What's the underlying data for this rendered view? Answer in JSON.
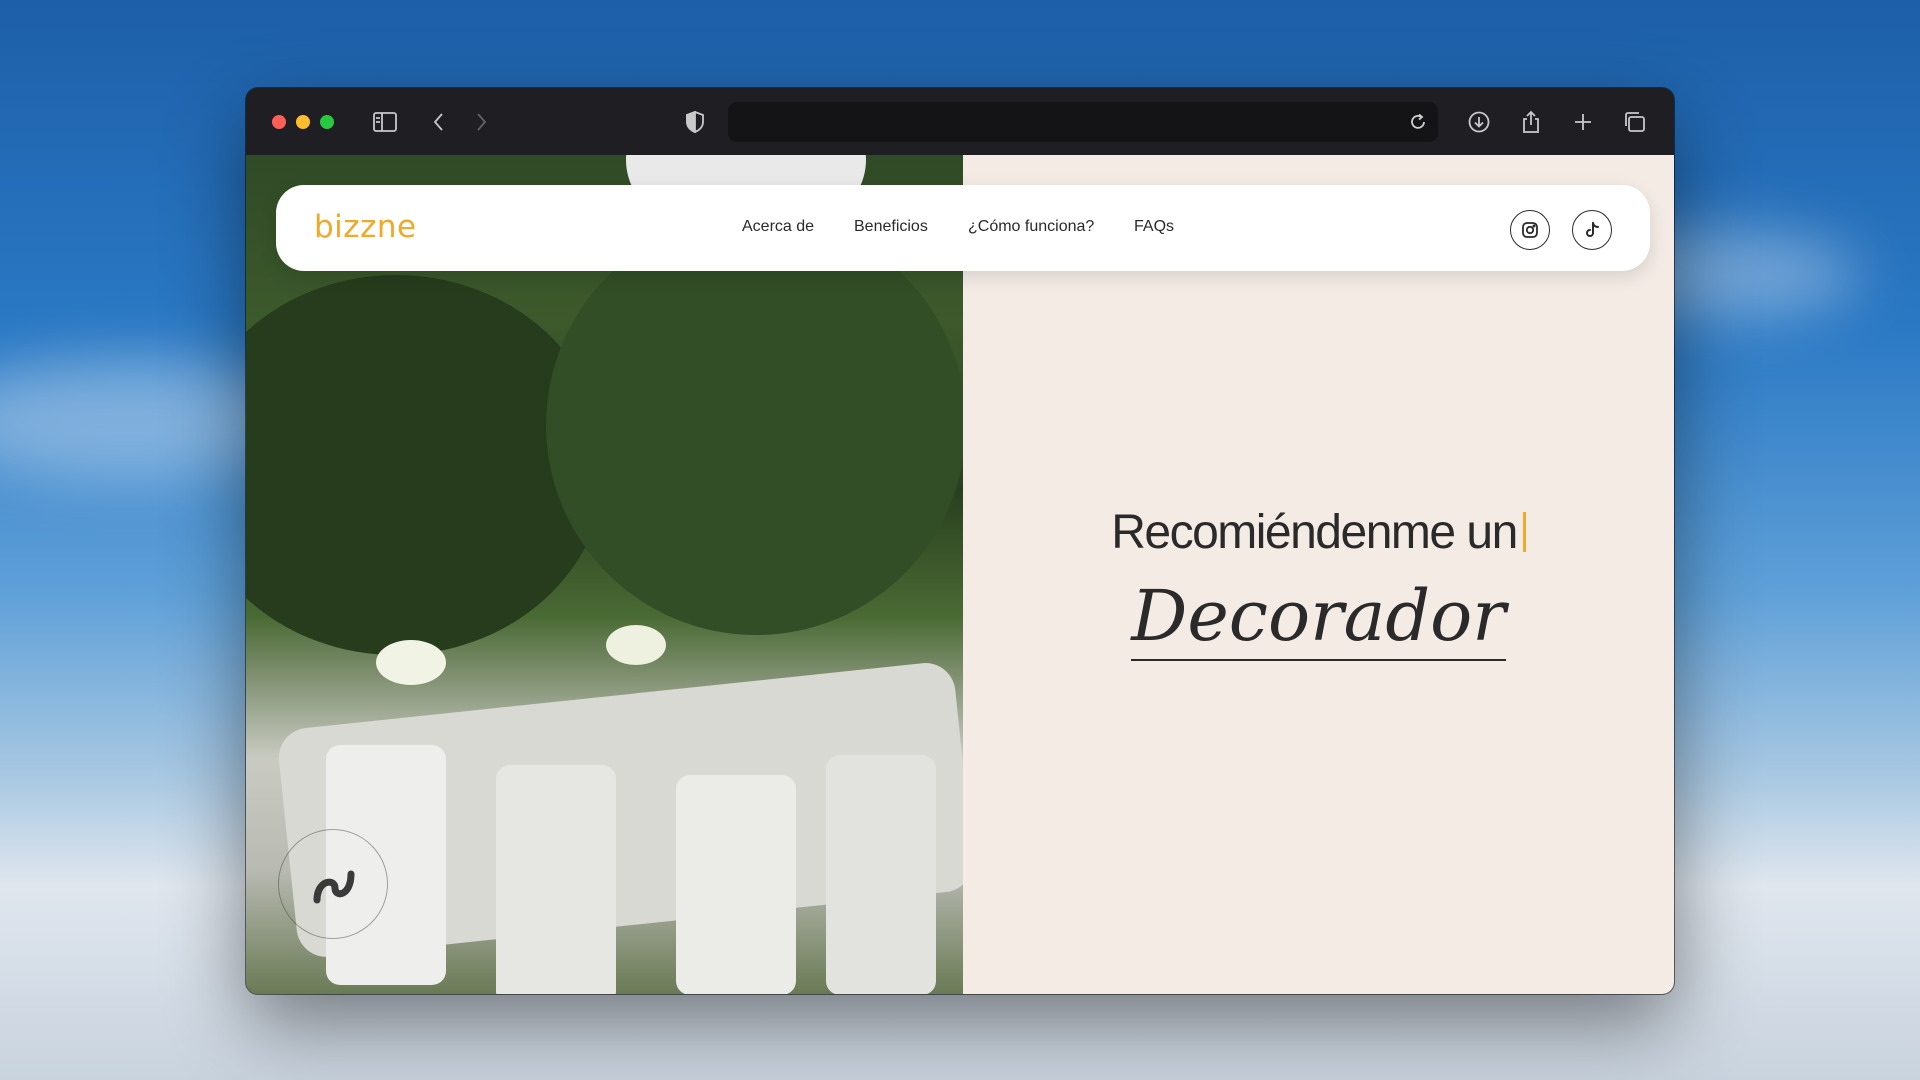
{
  "browser": {
    "address_text": "",
    "icons": {
      "sidebar": "sidebar-icon",
      "back": "chevron-left-icon",
      "forward": "chevron-right-icon",
      "privacy": "shield-icon",
      "reload": "reload-icon",
      "download": "download-icon",
      "share": "share-icon",
      "new_tab": "plus-icon",
      "tabs": "tabs-overview-icon"
    }
  },
  "site": {
    "logo": "bizzne",
    "nav": [
      "Acerca de",
      "Beneficios",
      "¿Cómo funciona?",
      "FAQs"
    ],
    "social": [
      "instagram-icon",
      "tiktok-icon"
    ],
    "hero": {
      "line1": "Recomiéndenme un",
      "line2": "Decorador"
    }
  },
  "colors": {
    "accent": "#f0a92a",
    "hero_bg": "#f4ebe5",
    "text": "#2a2a2a"
  }
}
